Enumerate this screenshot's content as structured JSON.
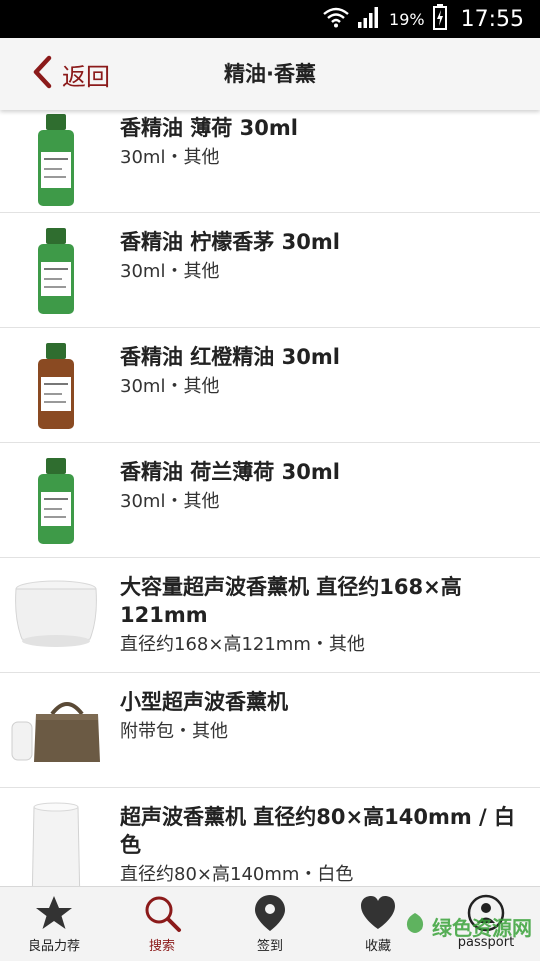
{
  "status_bar": {
    "battery": "19%",
    "time": "17:55",
    "icons": [
      "wifi-icon",
      "signal-icon",
      "battery-icon"
    ]
  },
  "header": {
    "back_label": "返回",
    "title": "精油·香薰"
  },
  "products": [
    {
      "title": "香精油 薄荷 30ml",
      "subtitle": "30ml・其他",
      "thumb": "green-oil-bottle"
    },
    {
      "title": "香精油 柠檬香茅 30ml",
      "subtitle": "30ml・其他",
      "thumb": "green-oil-bottle"
    },
    {
      "title": "香精油 红橙精油 30ml",
      "subtitle": "30ml・其他",
      "thumb": "amber-oil-bottle"
    },
    {
      "title": "香精油 荷兰薄荷 30ml",
      "subtitle": "30ml・其他",
      "thumb": "green-oil-bottle"
    },
    {
      "title": "大容量超声波香薰机 直径约168×高121mm",
      "subtitle": "直径约168×高121mm・其他",
      "thumb": "large-diffuser"
    },
    {
      "title": "小型超声波香薰机",
      "subtitle": "附带包・其他",
      "thumb": "small-diffuser-with-bag"
    },
    {
      "title": "超声波香薰机 直径约80×高140mm / 白色",
      "subtitle": "直径约80×高140mm・白色",
      "thumb": "tall-diffuser"
    }
  ],
  "bottom_nav": [
    {
      "label": "良品力荐",
      "icon": "star-icon",
      "active": false
    },
    {
      "label": "搜索",
      "icon": "search-icon",
      "active": true
    },
    {
      "label": "签到",
      "icon": "location-pin-icon",
      "active": false
    },
    {
      "label": "收藏",
      "icon": "heart-icon",
      "active": false
    },
    {
      "label": "passport",
      "icon": "person-icon",
      "active": false
    }
  ],
  "watermark": "绿色资源网",
  "colors": {
    "accent": "#8b1a1a",
    "status_bar": "#000000",
    "header_bg": "#f5f5f5",
    "divider": "#e2e2e2",
    "nav_bg": "#f3f3f3"
  }
}
